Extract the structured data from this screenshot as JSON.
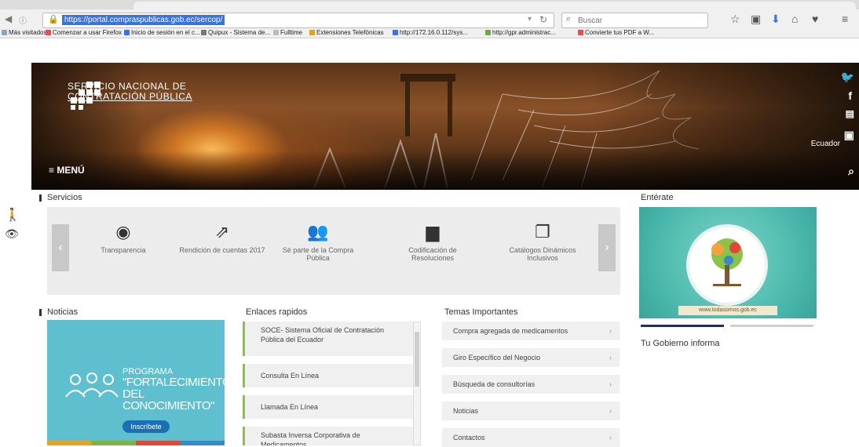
{
  "browser": {
    "url": "https://portal.compraspublicas.gob.ec/sercop/",
    "search_placeholder": "Buscar",
    "bookmarks": [
      {
        "label": "Más visitados",
        "color": "#8aa4c8"
      },
      {
        "label": "Comenzar a usar Firefox",
        "color": "#d9534f"
      },
      {
        "label": "Inicio de sesión en el c...",
        "color": "#3a73d9"
      },
      {
        "label": "Quipux - Sistema de...",
        "color": "#777777"
      },
      {
        "label": "Fulltime",
        "color": "#bbbbbb"
      },
      {
        "label": "Extensiones Telefónicas",
        "color": "#e0a030"
      },
      {
        "label": "http://172.16.0.112/sys...",
        "color": "#3a73d9"
      },
      {
        "label": "http://gpr.administrac...",
        "color": "#6aa84f"
      },
      {
        "label": "Convierte tus PDF a W...",
        "color": "#d9534f"
      }
    ]
  },
  "hero": {
    "logo_line1": "SERVICIO NACIONAL DE",
    "logo_line2": "CONTRATACIÓN PÚBLICA",
    "menu_label": "≡ MENÚ",
    "caption": "Ecuador"
  },
  "services": {
    "title": "Servicios",
    "items": [
      {
        "label": "Transparencia",
        "icon": "eye-icon"
      },
      {
        "label": "Rendición de cuentas 2017",
        "icon": "share-icon"
      },
      {
        "label": "Sé parte de la Compra Pública",
        "icon": "people-icon"
      },
      {
        "label": "Codificación de Resoluciones",
        "icon": "folder-icon"
      },
      {
        "label": "Catálogos Dinámicos Inclusivos",
        "icon": "catalog-icon"
      }
    ]
  },
  "news": {
    "title": "Noticias",
    "program_line1": "PROGRAMA",
    "program_line2": "\"FORTALECIMIENTO",
    "program_line3": "DEL CONOCIMIENTO\"",
    "cta": "Inscríbete"
  },
  "quick_links": {
    "title": "Enlaces rapidos",
    "items": [
      "SOCE- Sistema Oficial de Contratación Pública del Ecuador",
      "Consulta En Línea",
      "Llamada En Línea",
      "Subasta Inversa Corporativa de Medicamentos"
    ]
  },
  "topics": {
    "title": "Temas Importantes",
    "items": [
      "Compra agregada de medicamentos",
      "Giro Específico del Negocio",
      "Búsqueda de consultorías",
      "Noticias",
      "Contactos"
    ]
  },
  "enterate": {
    "title": "Entérate",
    "banner_url": "www.todasomos.gob.ec",
    "gov_title": "Tu Gobierno informa"
  },
  "colors": {
    "accent_green": "#8bc34a",
    "news_bg": "#5ec0cf",
    "banner_bg": "#49b6ab"
  }
}
